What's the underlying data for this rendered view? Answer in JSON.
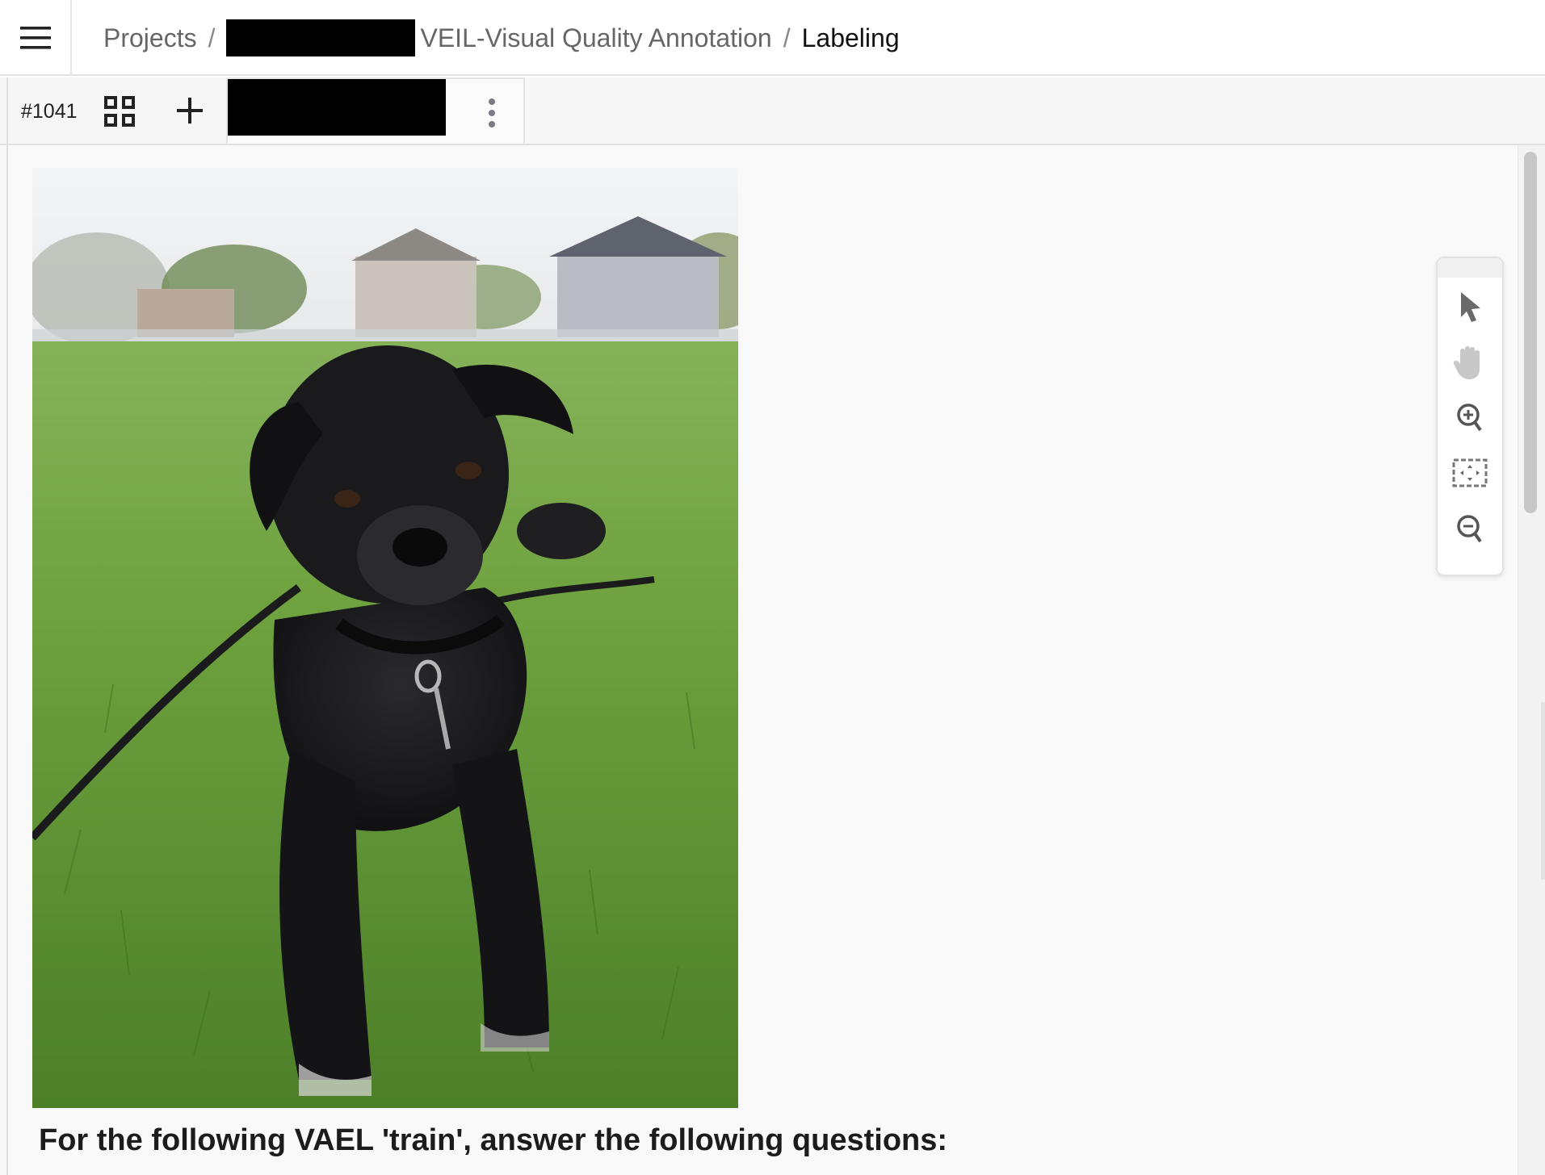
{
  "breadcrumb": {
    "projects": "Projects",
    "separator": "/",
    "project_name": "VEIL-Visual Quality Annotation",
    "current": "Labeling"
  },
  "task": {
    "id": "#1041"
  },
  "main": {
    "question": "For the following VAEL 'train', answer the following questions:"
  },
  "icons": {
    "menu": "hamburger-icon",
    "grid": "grid-view-icon",
    "add": "plus-icon",
    "more": "kebab-menu-icon",
    "select": "cursor-arrow-icon",
    "pan": "hand-icon",
    "zoom_in": "zoom-in-icon",
    "fit": "fit-to-screen-icon",
    "zoom_out": "zoom-out-icon"
  },
  "colors": {
    "redaction": "#000000",
    "icon_gray": "#6e6e6e",
    "background": "#f8f8f8"
  }
}
